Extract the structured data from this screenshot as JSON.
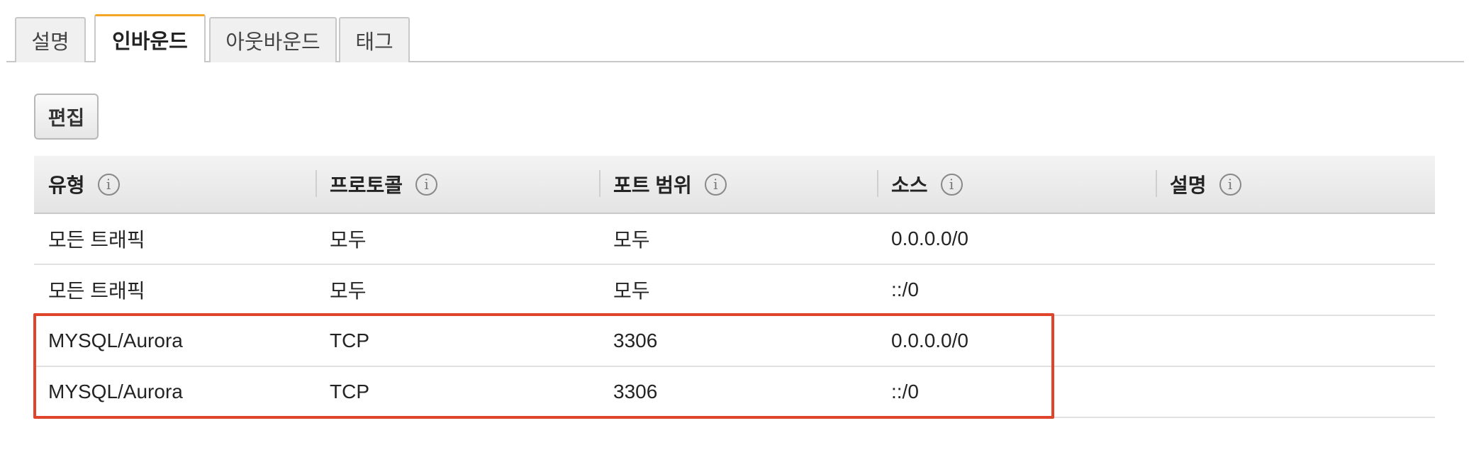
{
  "tabs": [
    {
      "label": "설명",
      "active": false
    },
    {
      "label": "인바운드",
      "active": true
    },
    {
      "label": "아웃바운드",
      "active": false
    },
    {
      "label": "태그",
      "active": false
    }
  ],
  "edit_button": "편집",
  "table": {
    "columns": [
      "유형",
      "프로토콜",
      "포트 범위",
      "소스",
      "설명"
    ],
    "info_glyph": "i",
    "rows": [
      [
        "모든 트래픽",
        "모두",
        "모두",
        "0.0.0.0/0",
        ""
      ],
      [
        "모든 트래픽",
        "모두",
        "모두",
        "::/0",
        ""
      ],
      [
        "MYSQL/Aurora",
        "TCP",
        "3306",
        "0.0.0.0/0",
        ""
      ],
      [
        "MYSQL/Aurora",
        "TCP",
        "3306",
        "::/0",
        ""
      ]
    ]
  },
  "highlight_color": "#e0442b",
  "accent_color": "#f5a623"
}
